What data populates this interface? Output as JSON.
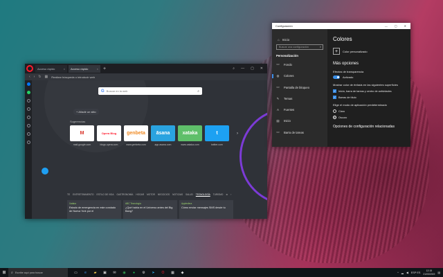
{
  "browser": {
    "tabs": [
      {
        "label": "Acceso rápido"
      },
      {
        "label": "Acceso rápido"
      }
    ],
    "address_placeholder": "Realizar búsqueda o introducir web",
    "search_placeholder": "Buscar en la web",
    "add_site_label": "+ Añadir un sitio",
    "suggestions_title": "Sugerencias",
    "speed_dials": [
      {
        "tile": "M",
        "label": "mail.google.com",
        "bg": "#ffffff",
        "fg": "#d93025"
      },
      {
        "tile": "Opera Blog",
        "label": "blogs.opera.com",
        "bg": "#ffffff",
        "fg": "#ff1b2d"
      },
      {
        "tile": "genbeta",
        "label": "www.genbeta.com",
        "bg": "#ffffff",
        "fg": "#f08a24"
      },
      {
        "tile": "āsana",
        "label": "app.asana.com",
        "bg": "#2aa3e0",
        "fg": "#ffffff"
      },
      {
        "tile": "xataka",
        "label": "www.xataka.com",
        "bg": "#5fbf6a",
        "fg": "#ffffff"
      },
      {
        "tile": "t",
        "label": "twitter.com",
        "bg": "#1da1f2",
        "fg": "#ffffff"
      }
    ],
    "news_categories": [
      "TE",
      "ENTRETENIMIENTO",
      "ESTILO DE VIDA",
      "GASTRONOMÍA",
      "HOGAR",
      "MOTOR",
      "NEGOCIOS",
      "NOTICIAS",
      "SALUD",
      "TECNOLOGÍA",
      "TURISMO"
    ],
    "news_active_category": "TECNOLOGÍA",
    "news_cards": [
      {
        "source": "Xataka",
        "title": "Estado de emergencia en este condado de Nueva York por el"
      },
      {
        "source": "ABC Tecnología",
        "title": "¿Qué había en el Universo antes del Big Bang?"
      },
      {
        "source": "Applesfera",
        "title": "Cómo enviar mensajes SMS desde tu"
      }
    ]
  },
  "settings": {
    "window_title": "Configuración",
    "home_label": "Inicio",
    "search_placeholder": "Buscar una configuración",
    "section_label": "Personalización",
    "nav_items": [
      {
        "icon": "▭",
        "label": "Fondo"
      },
      {
        "icon": "◍",
        "label": "Colores"
      },
      {
        "icon": "▭",
        "label": "Pantalla de bloqueo"
      },
      {
        "icon": "✎",
        "label": "Temas"
      },
      {
        "icon": "A",
        "label": "Fuentes"
      },
      {
        "icon": "▤",
        "label": "Inicio"
      },
      {
        "icon": "▭",
        "label": "Barra de tareas"
      }
    ],
    "active_nav": "Colores",
    "heading": "Colores",
    "custom_color_label": "Color personalizado",
    "more_options": "Más opciones",
    "transparency_label": "Efectos de transparencia",
    "transparency_state": "Activado",
    "accent_surfaces_label": "Mostrar color de énfasis en las siguientes superficies",
    "checkbox_start": "Inicio, barra de tareas y centro de actividades",
    "checkbox_title_bars": "Barras de título",
    "app_mode_label": "Elige el modo de aplicación predeterminado",
    "mode_light": "Claro",
    "mode_dark": "Oscuro",
    "related_heading": "Opciones de configuración relacionadas"
  },
  "taskbar": {
    "search_placeholder": "Escribe aquí para buscar",
    "tray_lang": "ESP",
    "tray_region": "ES",
    "time": "12:15",
    "date": "21/03/2019"
  }
}
